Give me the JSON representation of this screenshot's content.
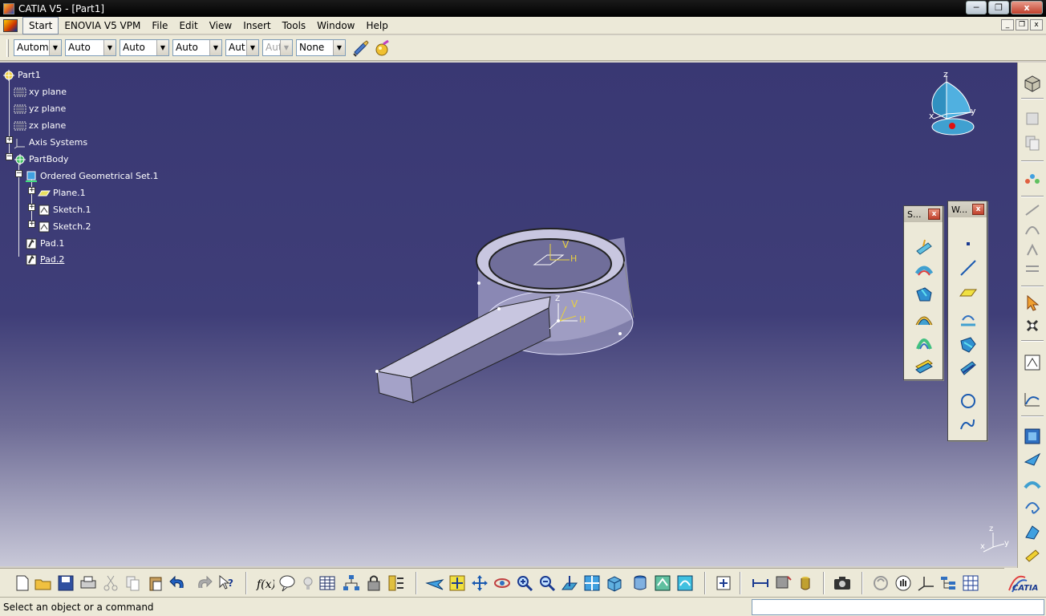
{
  "window": {
    "title": "CATIA V5 - [Part1]",
    "minimize": "─",
    "maximize": "❐",
    "close": "x"
  },
  "menu": {
    "items": [
      "Start",
      "ENOVIA V5 VPM",
      "File",
      "Edit",
      "View",
      "Insert",
      "Tools",
      "Window",
      "Help"
    ],
    "mdi_minimize": "_",
    "mdi_restore": "❐",
    "mdi_close": "x"
  },
  "properties": {
    "combos": [
      {
        "value": "Automa",
        "enabled": true
      },
      {
        "value": "Auto",
        "enabled": true
      },
      {
        "value": "Auto",
        "enabled": true
      },
      {
        "value": "Auto",
        "enabled": true
      },
      {
        "value": "Aut",
        "enabled": true
      },
      {
        "value": "Aut",
        "enabled": false
      },
      {
        "value": "None",
        "enabled": true
      }
    ]
  },
  "tree": {
    "part": "Part1",
    "xy_plane": "xy plane",
    "yz_plane": "yz plane",
    "zx_plane": "zx plane",
    "axis_systems": "Axis Systems",
    "partbody": "PartBody",
    "ogs": "Ordered Geometrical Set.1",
    "plane1": "Plane.1",
    "sketch1": "Sketch.1",
    "sketch2": "Sketch.2",
    "pad1": "Pad.1",
    "pad2": "Pad.2"
  },
  "compass": {
    "x": "x",
    "y": "y",
    "z": "z"
  },
  "sketch_axes": {
    "v": "V",
    "h": "H",
    "z": "Z"
  },
  "triad": {
    "x": "x",
    "y": "y",
    "z": "z"
  },
  "floatbars": {
    "s_title": "S...",
    "w_title": "W..."
  },
  "status": {
    "message": "Select an object or a command",
    "command": ""
  },
  "brand": {
    "logo_text": "CATIA"
  }
}
